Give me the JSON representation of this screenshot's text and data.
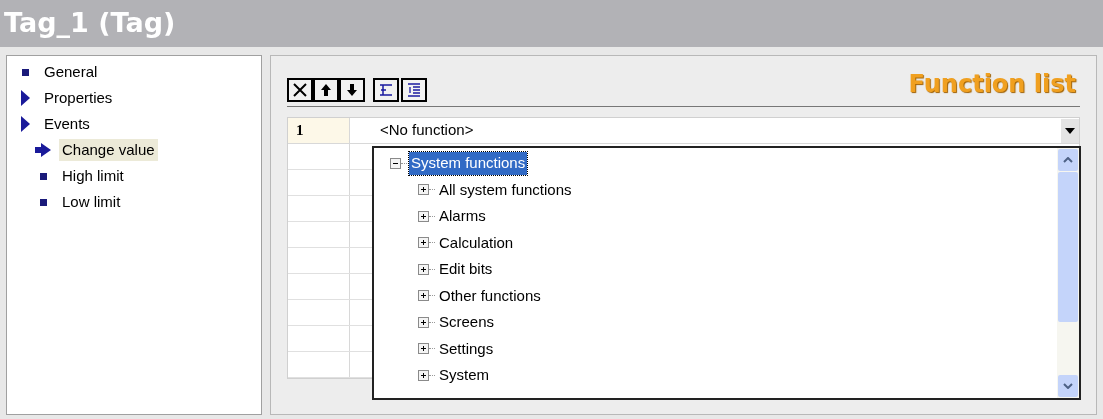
{
  "window": {
    "title": "Tag_1 (Tag)"
  },
  "nav": [
    {
      "label": "General",
      "kind": "bullet",
      "selected": false
    },
    {
      "label": "Properties",
      "kind": "arrow",
      "selected": false
    },
    {
      "label": "Events",
      "kind": "arrow",
      "selected": false,
      "children": [
        {
          "label": "Change value",
          "kind": "arrow",
          "selected": true
        },
        {
          "label": "High limit",
          "kind": "bullet",
          "selected": false
        },
        {
          "label": "Low limit",
          "kind": "bullet",
          "selected": false
        }
      ]
    }
  ],
  "heading": "Function list",
  "table": {
    "rows": [
      {
        "number": "1",
        "value": "<No function>"
      }
    ]
  },
  "tree": [
    {
      "label": "System functions",
      "expanded": true,
      "selected": true,
      "children": [
        {
          "label": "All system functions",
          "expanded": false,
          "selected": false
        },
        {
          "label": "Alarms",
          "expanded": false,
          "selected": false
        },
        {
          "label": "Calculation",
          "expanded": false,
          "selected": false
        },
        {
          "label": "Edit bits",
          "expanded": false,
          "selected": false
        },
        {
          "label": "Other functions",
          "expanded": false,
          "selected": false
        },
        {
          "label": "Screens",
          "expanded": false,
          "selected": false
        },
        {
          "label": "Settings",
          "expanded": false,
          "selected": false
        },
        {
          "label": "System",
          "expanded": false,
          "selected": false
        }
      ]
    }
  ]
}
